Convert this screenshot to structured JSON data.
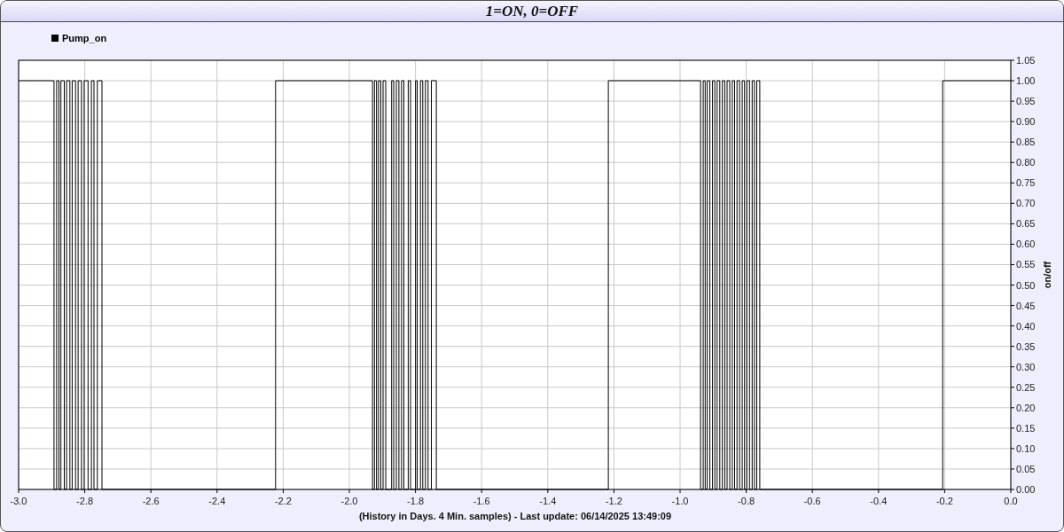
{
  "window": {
    "title": "1=ON, 0=OFF"
  },
  "chart_data": {
    "type": "line",
    "xlabel": "(History in Days. 4 Min. samples) - Last update: 06/14/2025 13:49:09",
    "ylabel": "on/off",
    "x": [
      -3.0,
      -2.893,
      -2.893,
      -2.885,
      -2.885,
      -2.878,
      -2.878,
      -2.872,
      -2.872,
      -2.862,
      -2.862,
      -2.855,
      -2.855,
      -2.845,
      -2.845,
      -2.838,
      -2.838,
      -2.828,
      -2.828,
      -2.82,
      -2.82,
      -2.81,
      -2.81,
      -2.802,
      -2.802,
      -2.79,
      -2.79,
      -2.78,
      -2.78,
      -2.772,
      -2.772,
      -2.762,
      -2.762,
      -2.748,
      -2.748,
      -2.223,
      -2.223,
      -1.93,
      -1.93,
      -1.924,
      -1.924,
      -1.918,
      -1.918,
      -1.912,
      -1.912,
      -1.905,
      -1.905,
      -1.898,
      -1.898,
      -1.89,
      -1.89,
      -1.872,
      -1.872,
      -1.866,
      -1.866,
      -1.858,
      -1.858,
      -1.85,
      -1.85,
      -1.842,
      -1.842,
      -1.835,
      -1.835,
      -1.822,
      -1.822,
      -1.815,
      -1.815,
      -1.8,
      -1.8,
      -1.795,
      -1.795,
      -1.785,
      -1.785,
      -1.778,
      -1.778,
      -1.77,
      -1.77,
      -1.762,
      -1.762,
      -1.752,
      -1.752,
      -1.737,
      -1.737,
      -1.217,
      -1.217,
      -0.938,
      -0.938,
      -0.93,
      -0.93,
      -0.924,
      -0.924,
      -0.918,
      -0.918,
      -0.91,
      -0.91,
      -0.902,
      -0.902,
      -0.895,
      -0.895,
      -0.888,
      -0.888,
      -0.88,
      -0.88,
      -0.872,
      -0.872,
      -0.865,
      -0.865,
      -0.858,
      -0.858,
      -0.85,
      -0.85,
      -0.842,
      -0.842,
      -0.835,
      -0.835,
      -0.828,
      -0.828,
      -0.82,
      -0.82,
      -0.812,
      -0.812,
      -0.805,
      -0.805,
      -0.798,
      -0.798,
      -0.79,
      -0.79,
      -0.782,
      -0.782,
      -0.775,
      -0.775,
      -0.768,
      -0.768,
      -0.759,
      -0.759,
      -0.206,
      -0.206,
      0.0
    ],
    "series": [
      {
        "name": "Pump_on",
        "color": "#000000",
        "values": [
          1,
          1,
          0,
          0,
          1,
          1,
          0,
          0,
          1,
          1,
          0,
          0,
          1,
          1,
          0,
          0,
          1,
          1,
          0,
          0,
          1,
          1,
          0,
          0,
          1,
          1,
          0,
          0,
          1,
          1,
          0,
          0,
          1,
          1,
          0,
          0,
          1,
          1,
          0,
          0,
          1,
          1,
          0,
          0,
          1,
          1,
          0,
          0,
          1,
          1,
          0,
          0,
          1,
          1,
          0,
          0,
          1,
          1,
          0,
          0,
          1,
          1,
          0,
          0,
          1,
          1,
          0,
          0,
          1,
          1,
          0,
          0,
          1,
          1,
          0,
          0,
          1,
          1,
          0,
          0,
          1,
          1,
          0,
          0,
          1,
          1,
          0,
          0,
          1,
          1,
          0,
          0,
          1,
          1,
          0,
          0,
          1,
          1,
          0,
          0,
          1,
          1,
          0,
          0,
          1,
          1,
          0,
          0,
          1,
          1,
          0,
          0,
          1,
          1,
          0,
          0,
          1,
          1,
          0,
          0,
          1,
          1,
          0,
          0,
          1,
          1,
          0,
          0,
          1,
          1,
          0,
          0,
          1,
          1,
          0,
          0,
          1,
          1
        ]
      }
    ],
    "grid": true,
    "xlim": [
      -3.0,
      0.0
    ],
    "ylim": [
      0,
      1.05
    ],
    "xticks": [
      {
        "value": -3.0,
        "label": "-3.0"
      },
      {
        "value": -2.8,
        "label": "-2.8"
      },
      {
        "value": -2.6,
        "label": "-2.6"
      },
      {
        "value": -2.4,
        "label": "-2.4"
      },
      {
        "value": -2.2,
        "label": "-2.2"
      },
      {
        "value": -2.0,
        "label": "-2.0"
      },
      {
        "value": -1.8,
        "label": "-1.8"
      },
      {
        "value": -1.6,
        "label": "-1.6"
      },
      {
        "value": -1.4,
        "label": "-1.4"
      },
      {
        "value": -1.2,
        "label": "-1.2"
      },
      {
        "value": -1.0,
        "label": "-1.0"
      },
      {
        "value": -0.8,
        "label": "-0.8"
      },
      {
        "value": -0.6,
        "label": "-0.6"
      },
      {
        "value": -0.4,
        "label": "-0.4"
      },
      {
        "value": -0.2,
        "label": "-0.2"
      },
      {
        "value": 0.0,
        "label": "0.0"
      }
    ],
    "yticks": [
      {
        "value": 0,
        "label": "0.00"
      },
      {
        "value": 0.05,
        "label": "0.05"
      },
      {
        "value": 0.1,
        "label": "0.10"
      },
      {
        "value": 0.15,
        "label": "0.15"
      },
      {
        "value": 0.2,
        "label": "0.20"
      },
      {
        "value": 0.25,
        "label": "0.25"
      },
      {
        "value": 0.3,
        "label": "0.30"
      },
      {
        "value": 0.35,
        "label": "0.35"
      },
      {
        "value": 0.4,
        "label": "0.40"
      },
      {
        "value": 0.45,
        "label": "0.45"
      },
      {
        "value": 0.5,
        "label": "0.50"
      },
      {
        "value": 0.55,
        "label": "0.55"
      },
      {
        "value": 0.6,
        "label": "0.60"
      },
      {
        "value": 0.65,
        "label": "0.65"
      },
      {
        "value": 0.7,
        "label": "0.70"
      },
      {
        "value": 0.75,
        "label": "0.75"
      },
      {
        "value": 0.8,
        "label": "0.80"
      },
      {
        "value": 0.85,
        "label": "0.85"
      },
      {
        "value": 0.9,
        "label": "0.90"
      },
      {
        "value": 0.95,
        "label": "0.95"
      },
      {
        "value": 1.0,
        "label": "1.00"
      },
      {
        "value": 1.05,
        "label": "1.05"
      }
    ]
  }
}
